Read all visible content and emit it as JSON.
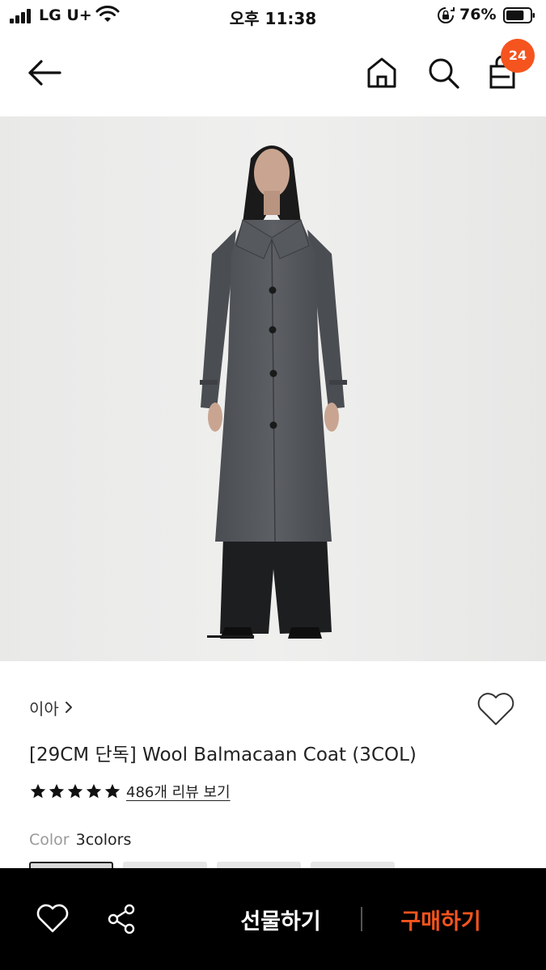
{
  "status_bar": {
    "carrier": "LG U+",
    "time": "오후 11:38",
    "battery_percent": "76%",
    "battery_level": 0.76
  },
  "header": {
    "cart_count": "24",
    "icons": [
      "back-arrow-icon",
      "home-icon",
      "search-icon",
      "shopping-bag-icon"
    ]
  },
  "product": {
    "image_index": 1,
    "brand": "이아",
    "title": "[29CM 단독] Wool Balmacaan Coat (3COL)",
    "rating_stars": 5,
    "review_link": "486개 리뷰 보기",
    "color_label": "Color",
    "color_value": "3colors",
    "swatch_count": 4
  },
  "bottom_bar": {
    "gift_label": "선물하기",
    "buy_label": "구매하기"
  },
  "colors": {
    "accent": "#f5541e",
    "bottom_bar_bg": "#000000",
    "image_bg": "#ebebea"
  }
}
